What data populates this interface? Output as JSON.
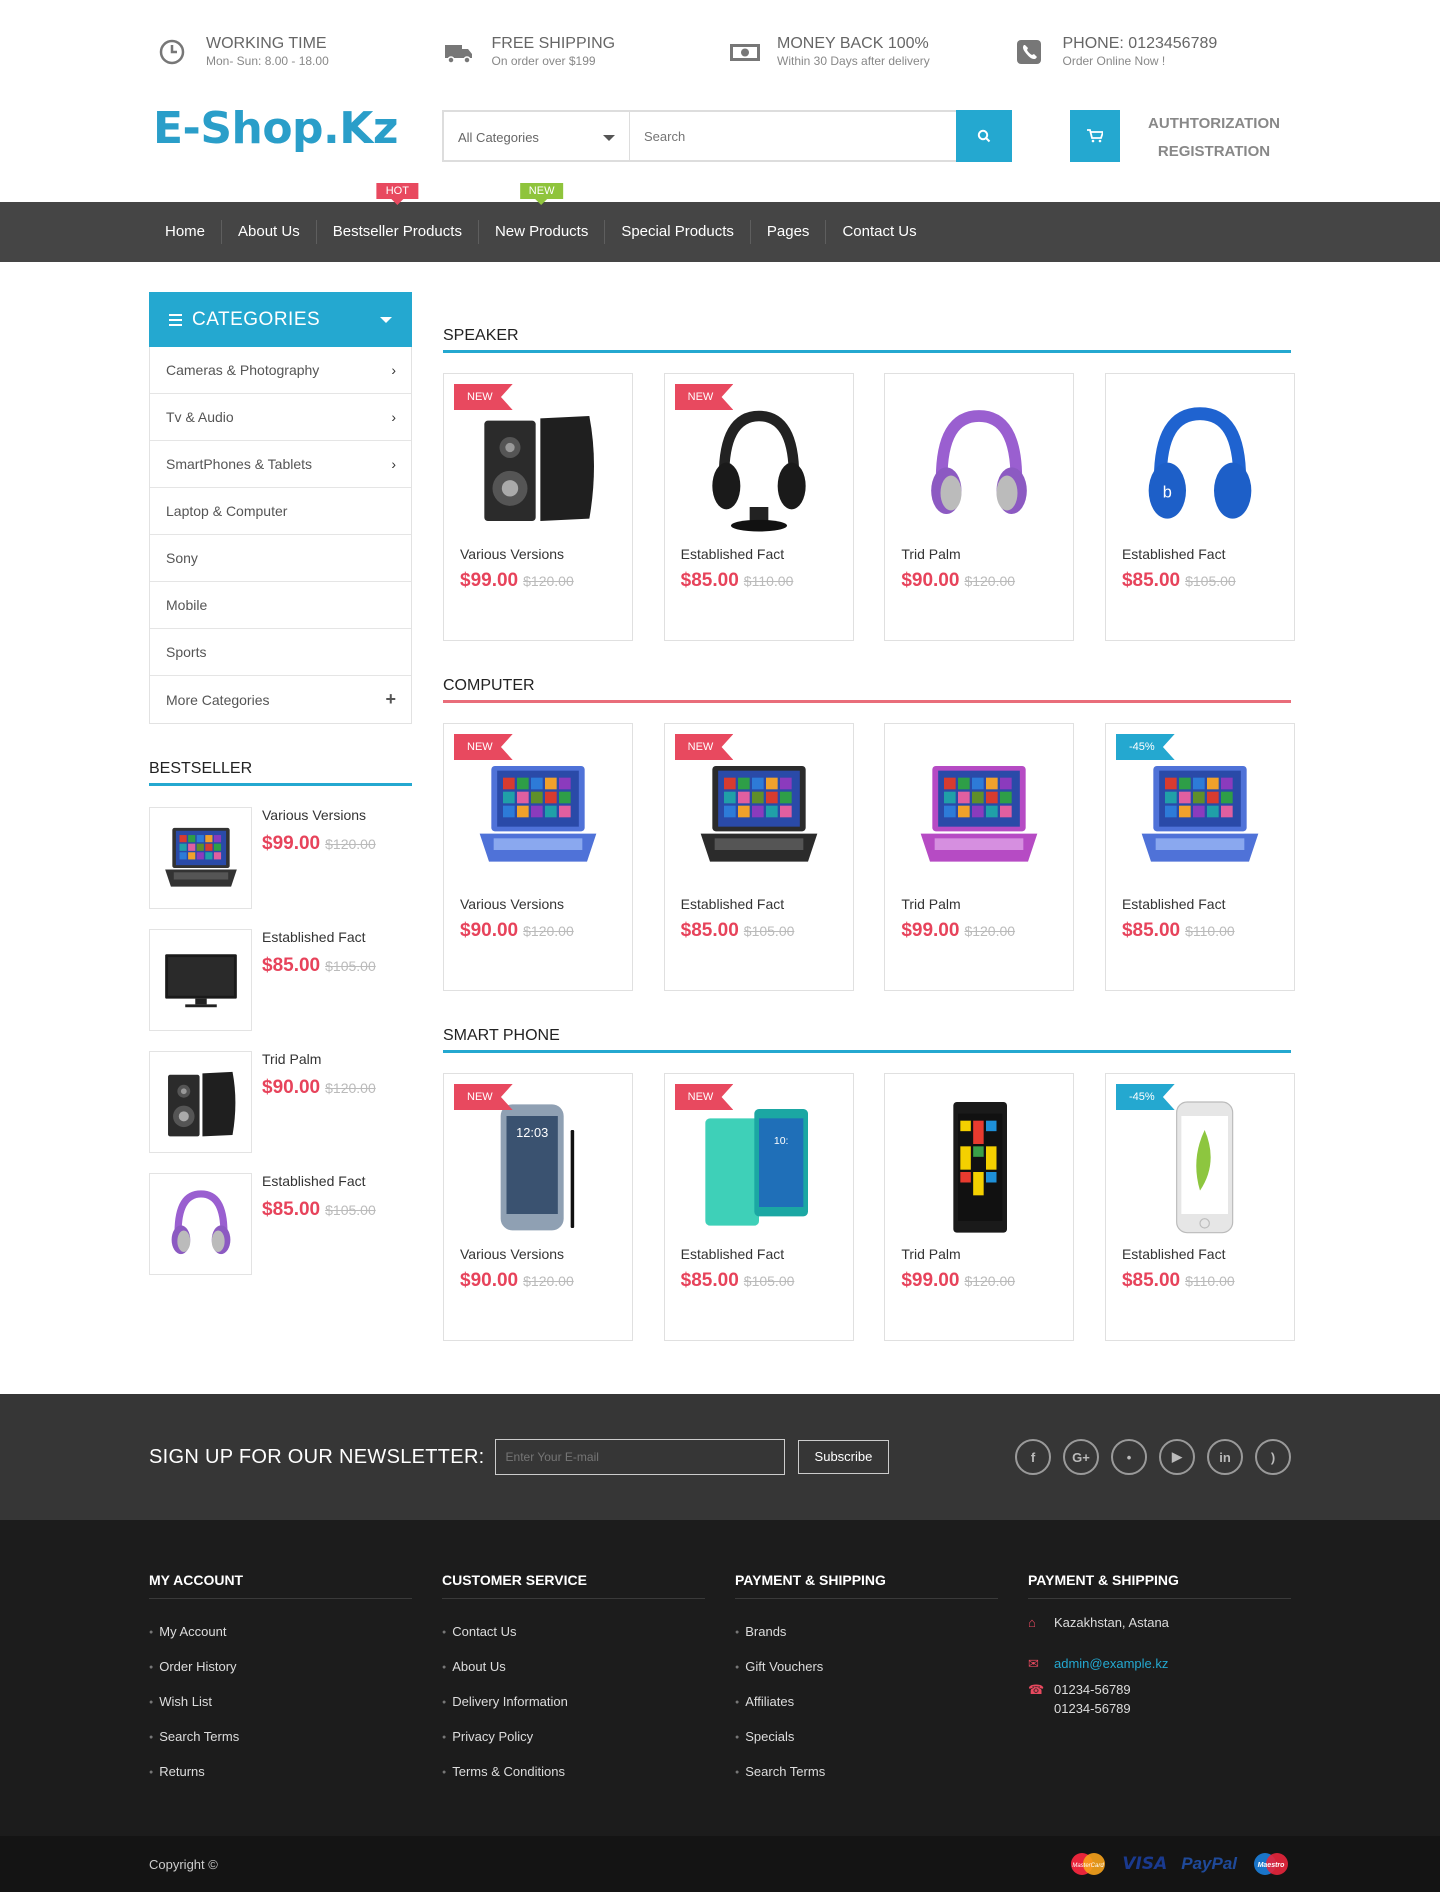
{
  "top_info": [
    {
      "icon": "clock-icon",
      "title": "WORKING TIME",
      "sub": "Mon- Sun: 8.00 - 18.00"
    },
    {
      "icon": "truck-icon",
      "title": "FREE SHIPPING",
      "sub": "On order over $199"
    },
    {
      "icon": "money-icon",
      "title": "MONEY BACK 100%",
      "sub": "Within 30 Days after delivery"
    },
    {
      "icon": "phone-icon",
      "title": "PHONE: 0123456789",
      "sub": "Order Online Now !"
    }
  ],
  "header": {
    "logo": "E-Shop.Kz",
    "category_select": "All Categories",
    "search_placeholder": "Search",
    "auth_link": "AUTHTORIZATION",
    "register_link": "REGISTRATION"
  },
  "nav": [
    {
      "label": "Home"
    },
    {
      "label": "About Us"
    },
    {
      "label": "Bestseller Products",
      "flag": "HOT"
    },
    {
      "label": "New Products",
      "flag": "NEW"
    },
    {
      "label": "Special Products"
    },
    {
      "label": "Pages"
    },
    {
      "label": "Contact Us"
    }
  ],
  "categories": {
    "title": "CATEGORIES",
    "items": [
      {
        "label": "Cameras & Photography",
        "has_sub": true
      },
      {
        "label": "Tv & Audio",
        "has_sub": true
      },
      {
        "label": "SmartPhones & Tablets",
        "has_sub": true
      },
      {
        "label": "Laptop & Computer"
      },
      {
        "label": "Sony"
      },
      {
        "label": "Mobile"
      },
      {
        "label": "Sports"
      },
      {
        "label": "More Categories",
        "more": true
      }
    ]
  },
  "bestseller": {
    "title": "BESTSELLER",
    "items": [
      {
        "name": "Various Versions",
        "price": "$99.00",
        "old": "$120.00",
        "image": "laptop"
      },
      {
        "name": "Established Fact",
        "price": "$85.00",
        "old": "$105.00",
        "image": "tv"
      },
      {
        "name": "Trid Palm",
        "price": "$90.00",
        "old": "$120.00",
        "image": "speaker"
      },
      {
        "name": "Established Fact",
        "price": "$85.00",
        "old": "$105.00",
        "image": "headphones-purple"
      }
    ]
  },
  "sections": [
    {
      "title": "SPEAKER",
      "products": [
        {
          "name": "Various Versions",
          "price": "$99.00",
          "old": "$120.00",
          "badge": "NEW",
          "image": "speaker"
        },
        {
          "name": "Established Fact",
          "price": "$85.00",
          "old": "$110.00",
          "badge": "NEW",
          "image": "headphones-black"
        },
        {
          "name": "Trid Palm",
          "price": "$90.00",
          "old": "$120.00",
          "badge": "",
          "image": "headphones-purple"
        },
        {
          "name": "Established Fact",
          "price": "$85.00",
          "old": "$105.00",
          "badge": "",
          "image": "headphones-blue"
        }
      ]
    },
    {
      "title": "COMPUTER",
      "products": [
        {
          "name": "Various Versions",
          "price": "$90.00",
          "old": "$120.00",
          "badge": "NEW",
          "image": "laptop-blue"
        },
        {
          "name": "Established Fact",
          "price": "$85.00",
          "old": "$105.00",
          "badge": "NEW",
          "image": "laptop-black"
        },
        {
          "name": "Trid Palm",
          "price": "$99.00",
          "old": "$120.00",
          "badge": "",
          "image": "laptop-pink"
        },
        {
          "name": "Established Fact",
          "price": "$85.00",
          "old": "$110.00",
          "badge": "-45%",
          "image": "laptop-blue"
        }
      ]
    },
    {
      "title": "SMART PHONE",
      "products": [
        {
          "name": "Various Versions",
          "price": "$90.00",
          "old": "$120.00",
          "badge": "NEW",
          "image": "phone-galaxy"
        },
        {
          "name": "Established Fact",
          "price": "$85.00",
          "old": "$105.00",
          "badge": "NEW",
          "image": "phone-xperia"
        },
        {
          "name": "Trid Palm",
          "price": "$99.00",
          "old": "$120.00",
          "badge": "",
          "image": "phone-lumia"
        },
        {
          "name": "Established Fact",
          "price": "$85.00",
          "old": "$110.00",
          "badge": "-45%",
          "image": "phone-iphone"
        }
      ]
    }
  ],
  "newsletter": {
    "title": "SIGN UP FOR OUR NEWSLETTER:",
    "placeholder": "Enter Your E-mail",
    "button": "Subscribe",
    "socials": [
      "facebook-icon",
      "google-plus-icon",
      "twitter-icon",
      "youtube-icon",
      "linkedin-icon",
      "rss-icon"
    ]
  },
  "footer": {
    "my_account": {
      "title": "MY ACCOUNT",
      "links": [
        "My Account",
        "Order History",
        "Wish List",
        "Search Terms",
        "Returns"
      ]
    },
    "customer_service": {
      "title": "CUSTOMER SERVICE",
      "links": [
        "Contact Us",
        "About Us",
        "Delivery Information",
        "Privacy Policy",
        "Terms & Conditions"
      ]
    },
    "payment_shipping": {
      "title": "PAYMENT & SHIPPING",
      "links": [
        "Brands",
        "Gift Vouchers",
        "Affiliates",
        "Specials",
        "Search Terms"
      ]
    },
    "contact": {
      "title": "PAYMENT & SHIPPING",
      "address": "Kazakhstan, Astana",
      "email": "admin@example.kz",
      "phone1": "01234-56789",
      "phone2": "01234-56789"
    }
  },
  "bottom": {
    "copyright": "Copyright ©",
    "payments": [
      "MasterCard",
      "VISA",
      "PayPal",
      "Maestro"
    ]
  },
  "colors": {
    "accent": "#24a8d0",
    "price": "#e7435b",
    "hot": "#e8495f",
    "new": "#8fc43c"
  }
}
